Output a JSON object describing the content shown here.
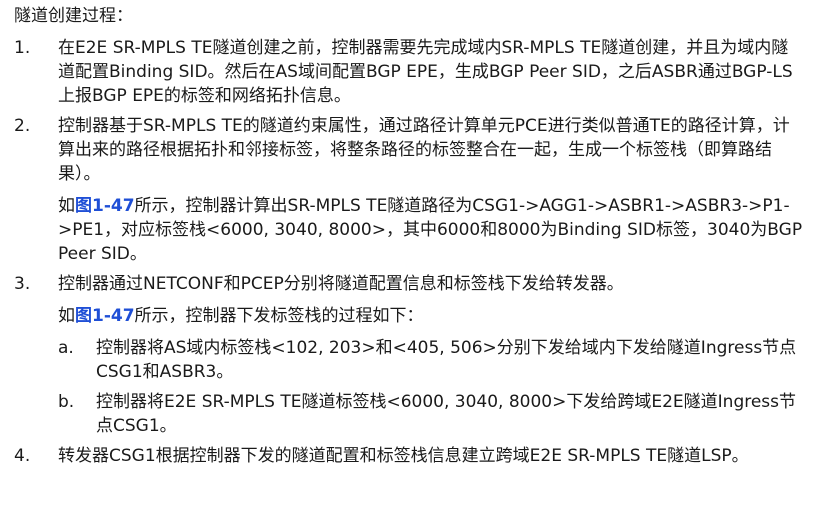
{
  "heading": "隧道创建过程：",
  "steps": [
    {
      "num": "1.",
      "text": "在E2E SR-MPLS TE隧道创建之前，控制器需要先完成域内SR-MPLS TE隧道创建，并且为域内隧道配置Binding SID。然后在AS域间配置BGP EPE，生成BGP Peer SID，之后ASBR通过BGP-LS上报BGP EPE的标签和网络拓扑信息。"
    },
    {
      "num": "2.",
      "text": "控制器基于SR-MPLS TE的隧道约束属性，通过路径计算单元PCE进行类似普通TE的路径计算，计算出来的路径根据拓扑和邻接标签，将整条路径的标签整合在一起，生成一个标签栈（即算路结果）。",
      "note_prefix": "如",
      "note_link": "图1-47",
      "note_suffix": "所示，控制器计算出SR-MPLS TE隧道路径为CSG1->AGG1->ASBR1->ASBR3->P1->PE1，对应标签栈<6000, 3040, 8000>，其中6000和8000为Binding SID标签，3040为BGP Peer SID。"
    },
    {
      "num": "3.",
      "text": "控制器通过NETCONF和PCEP分别将隧道配置信息和标签栈下发给转发器。",
      "note_prefix": "如",
      "note_link": "图1-47",
      "note_suffix": "所示，控制器下发标签栈的过程如下：",
      "substeps": [
        {
          "letter": "a.",
          "text": "控制器将AS域内标签栈<102, 203>和<405, 506>分别下发给域内下发给隧道Ingress节点CSG1和ASBR3。"
        },
        {
          "letter": "b.",
          "text": "控制器将E2E SR-MPLS TE隧道标签栈<6000, 3040, 8000>下发给跨域E2E隧道Ingress节点CSG1。"
        }
      ]
    },
    {
      "num": "4.",
      "text": "转发器CSG1根据控制器下发的隧道配置和标签栈信息建立跨域E2E SR-MPLS TE隧道LSP。"
    }
  ]
}
